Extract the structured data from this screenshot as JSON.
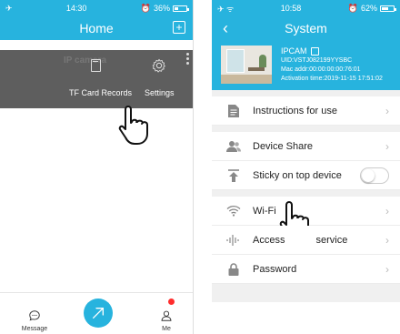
{
  "left_phone": {
    "status": {
      "time": "14:30",
      "battery": "36%",
      "battery_level": 0.36
    },
    "nav": {
      "title": "Home"
    },
    "camera_card": {
      "ghost_name": "IP camera",
      "actions": [
        {
          "label": "TF Card Records",
          "icon": "sd-card-icon"
        },
        {
          "label": "Settings",
          "icon": "gear-icon"
        }
      ]
    },
    "tabbar": {
      "tabs": [
        {
          "label": "Message",
          "icon": "chat-bubble-icon"
        },
        {
          "label": "",
          "icon": "add-device-icon"
        },
        {
          "label": "Me",
          "icon": "person-icon"
        }
      ]
    }
  },
  "right_phone": {
    "status": {
      "time": "10:58",
      "battery": "62%",
      "battery_level": 0.62
    },
    "nav": {
      "title": "System"
    },
    "device": {
      "name": "IPCAM",
      "uid": "UID:VSTJ082199YYSBC",
      "mac": "Mac addr:00:00:00:00:76:01",
      "activation": "Activation time:2019-11-15 17:51:02"
    },
    "menu": [
      {
        "label": "Instructions for use",
        "icon": "document-icon",
        "group": 1
      },
      {
        "label": "Device Share",
        "icon": "users-icon",
        "group": 2
      },
      {
        "label": "Sticky on top device",
        "icon": "pin-top-icon",
        "group": 2,
        "toggle": false
      },
      {
        "label": "Wi-Fi",
        "icon": "wifi-icon",
        "group": 3
      },
      {
        "label": "Access",
        "label_suffix": "service",
        "icon": "signal-icon",
        "group": 3
      },
      {
        "label": "Password",
        "icon": "lock-icon",
        "group": 3
      }
    ]
  },
  "colors": {
    "accent": "#27b3de",
    "overlay": "#5e5e5e",
    "badge": "#ff2d2d"
  }
}
